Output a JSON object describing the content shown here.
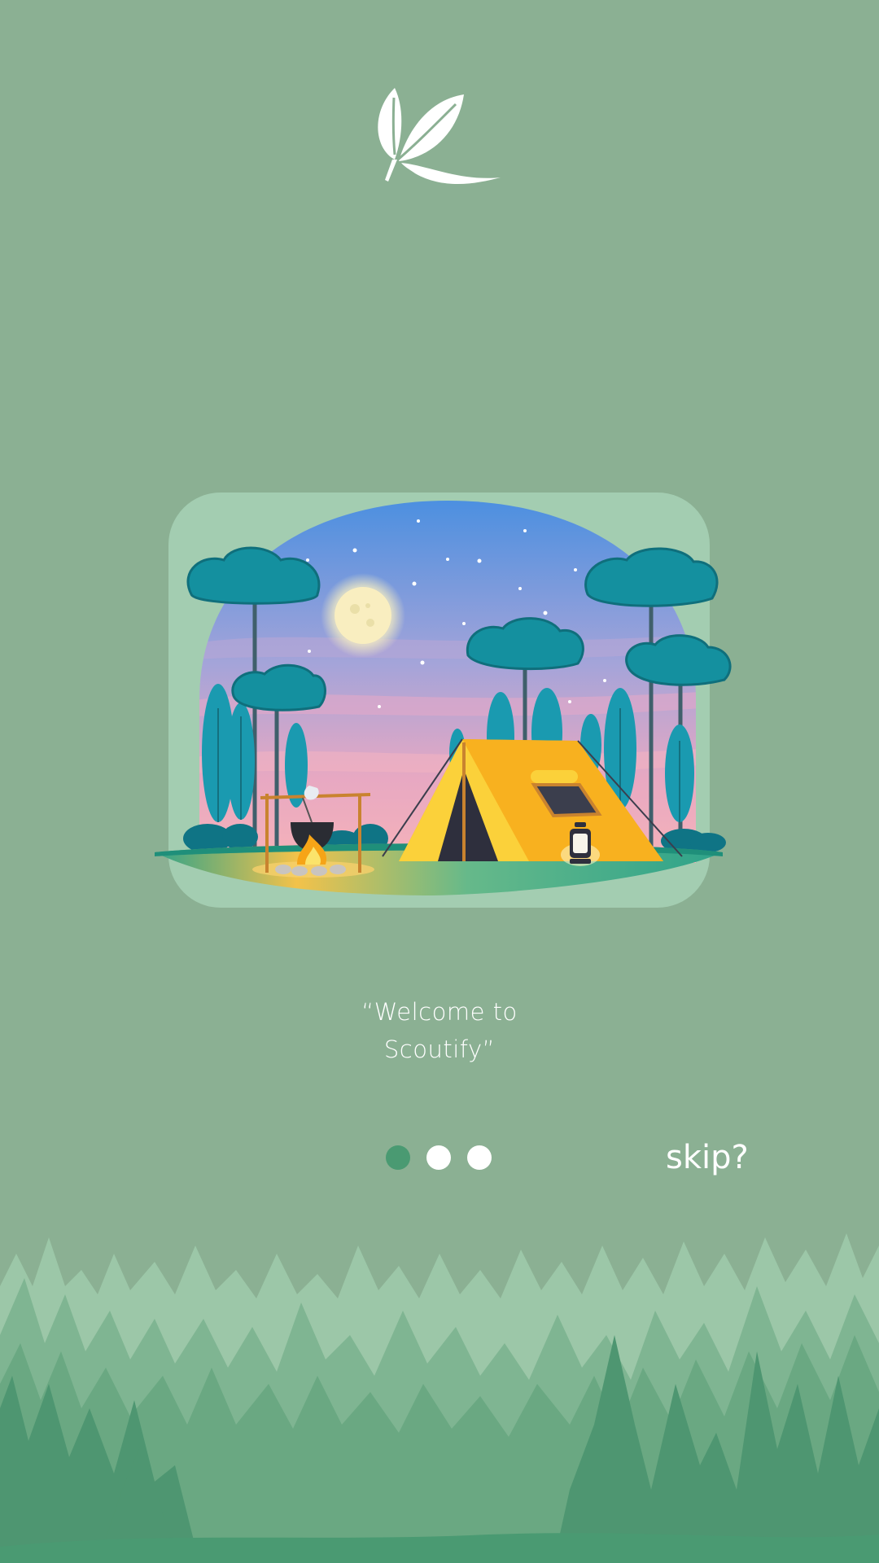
{
  "welcome": {
    "line1": "“Welcome to",
    "line2": "Scoutify”"
  },
  "pagination": {
    "total": 3,
    "active_index": 0
  },
  "skip": {
    "label": "skip?"
  },
  "colors": {
    "background": "#8bb093",
    "card": "#a3cdb1",
    "dot_active": "#4a9a72",
    "dot_inactive": "#ffffff",
    "text": "#ffffff",
    "tent": "#f6a417"
  },
  "icons": {
    "logo": "leaf-logo-icon",
    "illustration": "camping-scene-illustration",
    "footer": "pine-forest-silhouette"
  }
}
